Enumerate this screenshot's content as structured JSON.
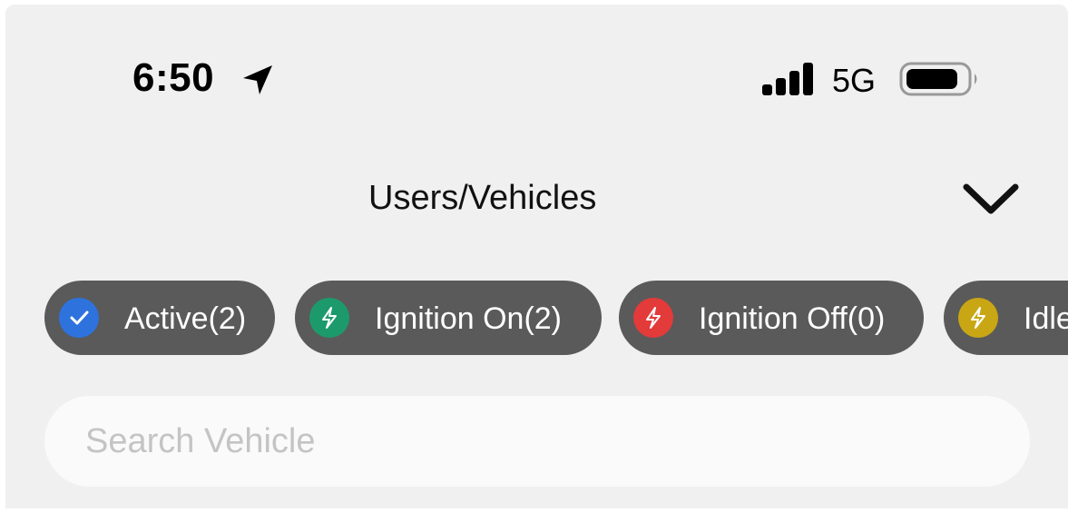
{
  "status_bar": {
    "time": "6:50",
    "location_icon": "location-arrow-icon",
    "signal_icon": "cellular-signal-icon",
    "network": "5G",
    "battery_icon": "battery-icon"
  },
  "header": {
    "title": "Users/Vehicles",
    "dropdown_icon": "chevron-down-icon"
  },
  "filters": [
    {
      "label": "Active(2)",
      "icon": "check-icon",
      "color": "#2e72de"
    },
    {
      "label": "Ignition On(2)",
      "icon": "lightning-icon",
      "color": "#1d9a6c"
    },
    {
      "label": "Ignition Off(0)",
      "icon": "lightning-icon",
      "color": "#e33a3a"
    },
    {
      "label": "Idle",
      "icon": "lightning-icon",
      "color": "#c9a714"
    }
  ],
  "search": {
    "placeholder": "Search Vehicle",
    "value": ""
  }
}
